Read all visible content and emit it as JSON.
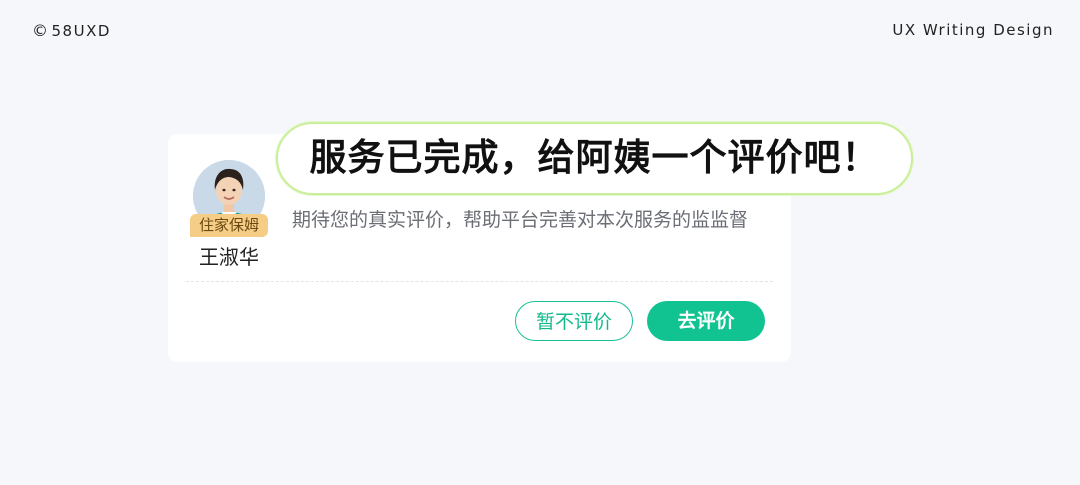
{
  "header": {
    "copyright_symbol": "©",
    "brand": "58UXD",
    "tagline": "UX Writing Design"
  },
  "card": {
    "title": "服务已完成，给阿姨一个评价吧！",
    "role_badge": "住家保姆",
    "worker_name": "王淑华",
    "description": "期待您的真实评价，帮助平台完善对本次服务的监监督",
    "buttons": {
      "skip": "暂不评价",
      "rate": "去评价"
    }
  },
  "colors": {
    "accent": "#11c391",
    "badge": "#f6cd86",
    "bubble_border": "#c9ef9a",
    "background": "#f6f7fb"
  },
  "icons": {
    "avatar": "worker-avatar-photo"
  }
}
